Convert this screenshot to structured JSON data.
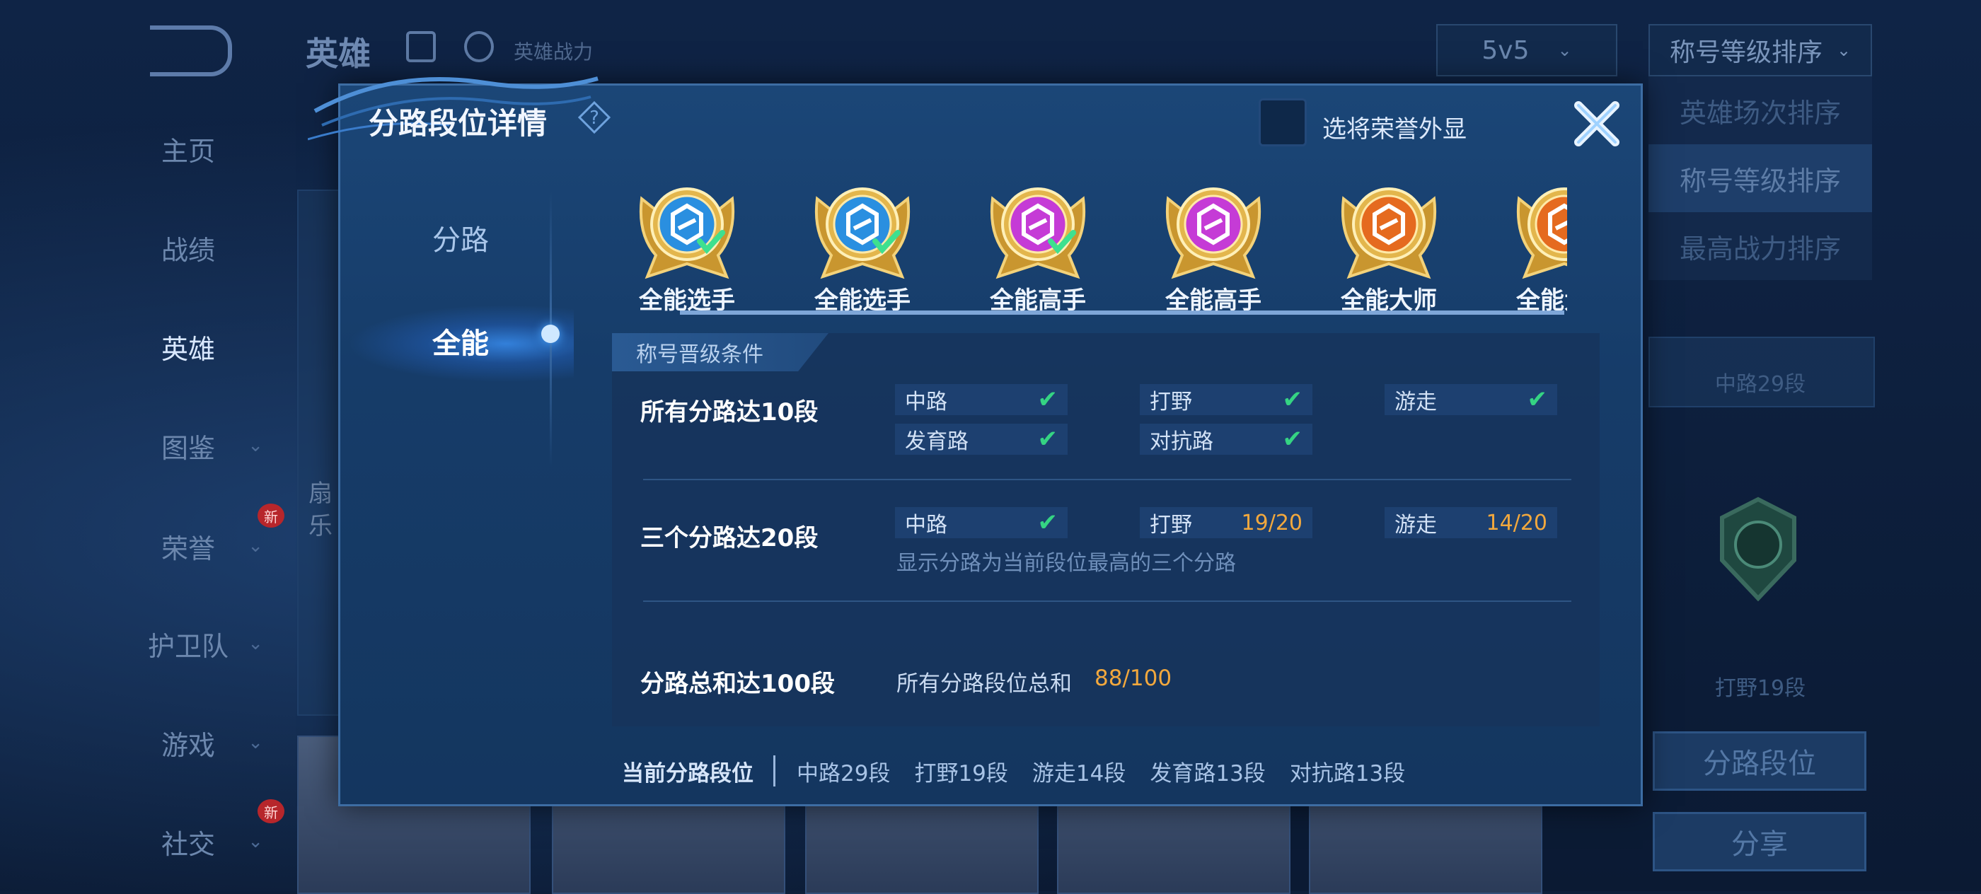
{
  "background": {
    "top_title": "英雄",
    "top_subtitle": "英雄战力",
    "mode_dropdown": "5v5",
    "sort_dropdown": "称号等级排序",
    "sort_options": [
      "英雄场次排序",
      "称号等级排序",
      "最高战力排序"
    ],
    "nav": [
      {
        "label": "主页"
      },
      {
        "label": "战绩"
      },
      {
        "label": "英雄"
      },
      {
        "label": "图鉴"
      },
      {
        "label": "荣誉",
        "badge": "新"
      },
      {
        "label": "护卫队"
      },
      {
        "label": "游戏"
      },
      {
        "label": "社交",
        "badge": "新"
      }
    ],
    "side_stats": [
      "中路29段",
      "打野19段"
    ],
    "side_buttons": [
      "分路段位",
      "分享"
    ],
    "card_text": [
      "扇",
      "乐"
    ]
  },
  "modal": {
    "title": "分路段位详情",
    "help_symbol": "?",
    "honor_toggle_label": "选将荣誉外显",
    "tabs": [
      "分路",
      "全能"
    ],
    "active_tab": "全能",
    "badges": [
      {
        "label": "全能选手",
        "color": "#2a8fe0",
        "achieved": true
      },
      {
        "label": "全能选手",
        "color": "#2a8fe0",
        "achieved": true
      },
      {
        "label": "全能高手",
        "color": "#c53bd6",
        "achieved": true
      },
      {
        "label": "全能高手",
        "color": "#c53bd6",
        "achieved": false
      },
      {
        "label": "全能大师",
        "color": "#e56a1f",
        "achieved": false
      },
      {
        "label": "全能大师",
        "color": "#e56a1f",
        "achieved": false
      }
    ],
    "conditions_header": "称号晋级条件",
    "conditions": {
      "c1": {
        "title": "所有分路达",
        "title_num": "10段",
        "items": [
          {
            "name": "中路",
            "status": "✔"
          },
          {
            "name": "打野",
            "status": "✔"
          },
          {
            "name": "游走",
            "status": "✔"
          },
          {
            "name": "发育路",
            "status": "✔"
          },
          {
            "name": "对抗路",
            "status": "✔"
          }
        ]
      },
      "c2": {
        "title": "三个分路达",
        "title_num": "20段",
        "items": [
          {
            "name": "中路",
            "status": "✔"
          },
          {
            "name": "打野",
            "progress": "19/20"
          },
          {
            "name": "游走",
            "progress": "14/20"
          }
        ],
        "note": "显示分路为当前段位最高的三个分路"
      },
      "c3": {
        "title": "分路总和达",
        "title_num": "100段",
        "label": "所有分路段位总和",
        "progress": "88/100"
      }
    },
    "footer": {
      "label": "当前分路段位",
      "segments": [
        "中路29段",
        "打野19段",
        "游走14段",
        "发育路13段",
        "对抗路13段"
      ]
    }
  }
}
